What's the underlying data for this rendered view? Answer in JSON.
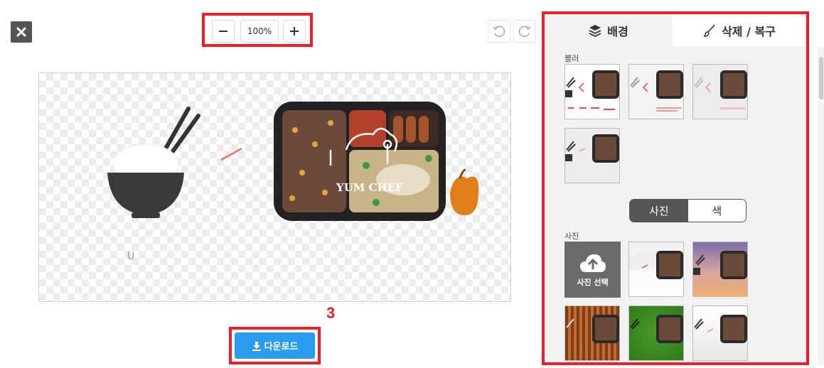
{
  "toolbar": {
    "zoom_value": "100%"
  },
  "canvas": {
    "logo_text": "YUM CHEF"
  },
  "annotation": {
    "step_number": "3"
  },
  "download": {
    "label": "다운로드"
  },
  "panel": {
    "tabs": [
      {
        "label": "배경",
        "icon": "layers-icon"
      },
      {
        "label": "삭제 / 복구",
        "icon": "brush-icon"
      }
    ],
    "blur_label": "블러",
    "toggle": {
      "photo": "사진",
      "color": "색"
    },
    "photo_label": "사진",
    "upload_label": "사진 선택"
  },
  "colors": {
    "accent_red": "#e8202a",
    "download_blue": "#2a9cf0",
    "panel_bg": "#f2f2f2",
    "toggle_active": "#555555"
  }
}
